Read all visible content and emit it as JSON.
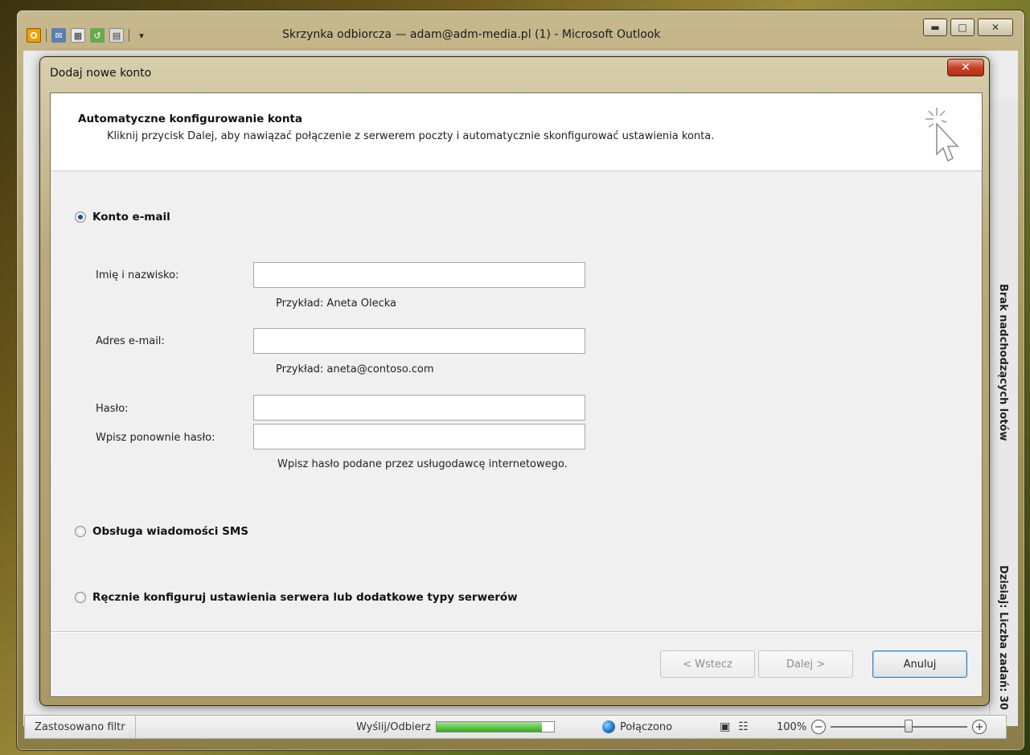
{
  "outlook": {
    "window_title": "Skrzynka odbiorcza — adam@adm-media.pl (1)  -  Microsoft Outlook",
    "right_panel_texts": [
      "Brak nadchodzących lotów",
      "Dzisiaj: Liczba zadań: 30"
    ],
    "status_bar": {
      "filter_label": "Zastosowano filtr",
      "send_receive_label": "Wyślij/Odbierz",
      "send_receive_progress": 0.9,
      "connection_label": "Połączono",
      "zoom_label": "100%",
      "zoom_value": 100
    }
  },
  "dialog": {
    "title": "Dodaj nowe konto",
    "header_title": "Automatyczne konfigurowanie konta",
    "header_subtitle": "Kliknij przycisk Dalej, aby nawiązać połączenie z serwerem poczty i automatycznie skonfigurować ustawienia konta.",
    "options": {
      "email_account": "Konto e-mail",
      "sms": "Obsługa wiadomości SMS",
      "manual": "Ręcznie konfiguruj ustawienia serwera lub dodatkowe typy serwerów"
    },
    "selected_option": "email_account",
    "fields": {
      "name_label": "Imię i nazwisko:",
      "name_value": "",
      "name_hint": "Przykład: Aneta Olecka",
      "email_label": "Adres e-mail:",
      "email_value": "",
      "email_hint": "Przykład: aneta@contoso.com",
      "password_label": "Hasło:",
      "password_value": "",
      "password_confirm_label": "Wpisz ponownie hasło:",
      "password_confirm_value": "",
      "password_hint": "Wpisz hasło podane przez usługodawcę internetowego."
    },
    "buttons": {
      "back": "< Wstecz",
      "next": "Dalej >",
      "cancel": "Anuluj"
    }
  },
  "colors": {
    "accent": "#1f4f9a",
    "dialog_close": "#c4412a",
    "progress": "#3aa81f"
  }
}
